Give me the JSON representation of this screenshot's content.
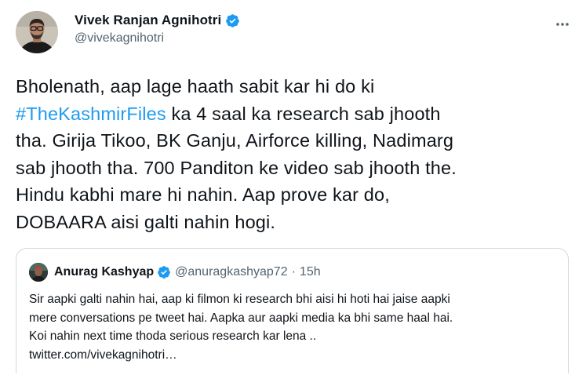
{
  "tweet": {
    "display_name": "Vivek Ranjan Agnihotri",
    "handle": "@vivekagnihotri",
    "text_before_hashtag": "Bholenath, aap lage haath sabit kar hi do ki\n",
    "hashtag": "#TheKashmirFiles",
    "text_after_hashtag": " ka 4 saal ka research sab jhooth\ntha. Girija Tikoo, BK Ganju, Airforce killing, Nadimarg\nsab jhooth tha. 700 Panditon ke video sab jhooth the.\nHindu kabhi mare hi nahin. Aap prove kar do,\nDOBAARA aisi galti nahin hogi."
  },
  "quoted_tweet": {
    "display_name": "Anurag Kashyap",
    "handle": "@anuragkashyap72",
    "dot": "·",
    "time": "15h",
    "lines": [
      "Sir aapki galti nahin hai, aap ki filmon ki research bhi aisi hi hoti hai jaise aapki",
      "mere conversations pe tweet hai. Aapka aur aapki media ka bhi same haal hai.",
      "Koi nahin next time thoda serious research kar lena ..",
      "twitter.com/vivekagnihotri…"
    ]
  },
  "colors": {
    "accent": "#1d9bf0",
    "text": "#0f1419",
    "secondary": "#536471",
    "border": "#cfd9de"
  },
  "icons": {
    "verified": "verified-badge-icon",
    "more": "more-options-icon"
  }
}
